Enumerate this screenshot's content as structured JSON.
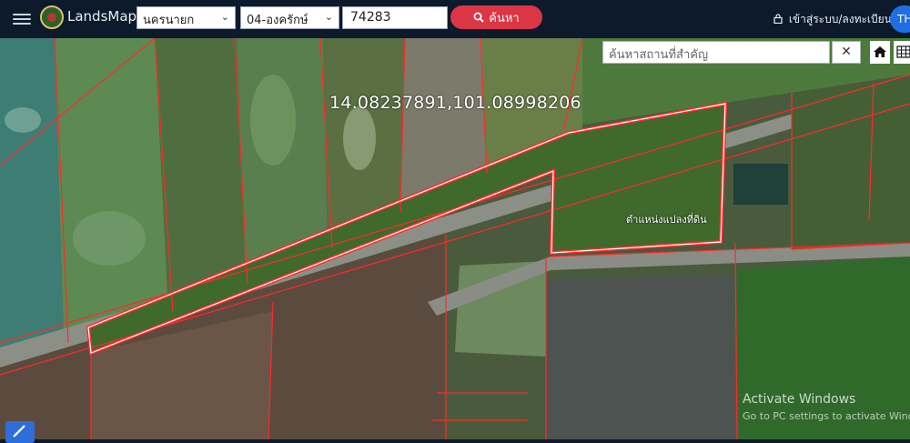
{
  "header": {
    "brand": "LandsMaps",
    "province_selected": "นครนายก",
    "district_selected": "04-องครักษ์",
    "parcel_number": "74283",
    "search_label": "ค้นหา",
    "login_label": "เข้าสู่ระบบ/ลงทะเบียน",
    "lang_label": "TH"
  },
  "map": {
    "place_search_placeholder": "ค้นหาสถานที่สำคัญ",
    "coordinates": "14.08237891,101.08998206",
    "parcel_label": "ตำแหน่งแปลงที่ดิน",
    "watermark_title": "Activate Windows",
    "watermark_subtitle": "Go to PC settings to activate Windows"
  },
  "colors": {
    "topbar": "#0c1a2c",
    "search_button": "#dc3545",
    "parcel_outline": "#ff2a2a",
    "lang_button": "#1f6fe0"
  },
  "icons": [
    "menu-icon",
    "logo-icon",
    "search-icon",
    "lock-icon",
    "close-icon",
    "home-icon",
    "grid-icon",
    "ruler-icon"
  ]
}
